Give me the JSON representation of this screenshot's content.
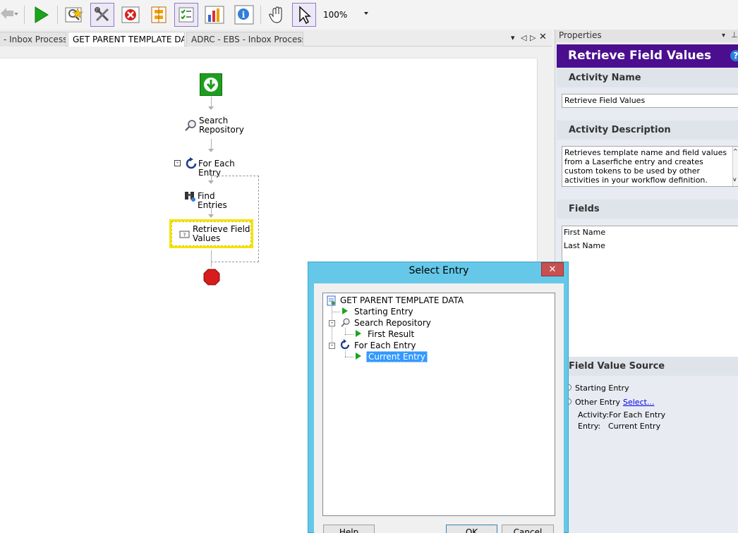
{
  "toolbar": {
    "zoom": "100%",
    "buttons": [
      {
        "name": "back-icon"
      },
      {
        "name": "run-icon"
      },
      {
        "name": "find-icon"
      },
      {
        "name": "tools-icon"
      },
      {
        "name": "stop-icon"
      },
      {
        "name": "compare-icon"
      },
      {
        "name": "checklist-icon"
      },
      {
        "name": "report-icon"
      },
      {
        "name": "info-icon"
      },
      {
        "name": "pan-hand-icon"
      },
      {
        "name": "pointer-icon"
      }
    ]
  },
  "tabs": [
    {
      "label": "- Inbox Processi...",
      "active": false
    },
    {
      "label": "GET PARENT TEMPLATE DA...",
      "active": true
    },
    {
      "label": "ADRC - EBS - Inbox Processi...",
      "active": false
    }
  ],
  "workflow": {
    "nodes": [
      {
        "label1": "Search",
        "label2": "Repository"
      },
      {
        "label1": "For Each Entry",
        "label2": ""
      },
      {
        "label1": "Find Entries",
        "label2": ""
      },
      {
        "label1": "Retrieve Field",
        "label2": "Values"
      }
    ]
  },
  "properties": {
    "panel_title": "Properties",
    "header": "Retrieve Field Values",
    "activity_name_label": "Activity Name",
    "activity_name_value": "Retrieve Field Values",
    "activity_description_label": "Activity Description",
    "activity_description_value": "Retrieves template name and field values from a Laserfiche entry and creates custom tokens to be used by other activities in your workflow definition.",
    "fields_label": "Fields",
    "fields": [
      "First Name",
      "Last Name"
    ],
    "field_value_source_label": "Field Value Source",
    "starting_entry_label": "Starting Entry",
    "other_entry_label": "Other Entry",
    "select_link": "Select...",
    "activity_label": "Activity:",
    "activity_value": "For Each Entry",
    "entry_label": "Entry:",
    "entry_value": "Current Entry"
  },
  "dialog": {
    "title": "Select Entry",
    "close": "✕",
    "tree": {
      "root": "GET PARENT TEMPLATE DATA",
      "starting_entry": "Starting Entry",
      "search_repository": "Search Repository",
      "first_result": "First Result",
      "for_each_entry": "For Each Entry",
      "current_entry": "Current Entry"
    },
    "help_button": "Help",
    "ok_button": "OK",
    "cancel_button": "Cancel"
  },
  "colors": {
    "accent_purple": "#4a0e8f",
    "dialog_frame": "#65c8e8",
    "selected_item": "#3399ff",
    "selection_frame": "#f4e300"
  }
}
